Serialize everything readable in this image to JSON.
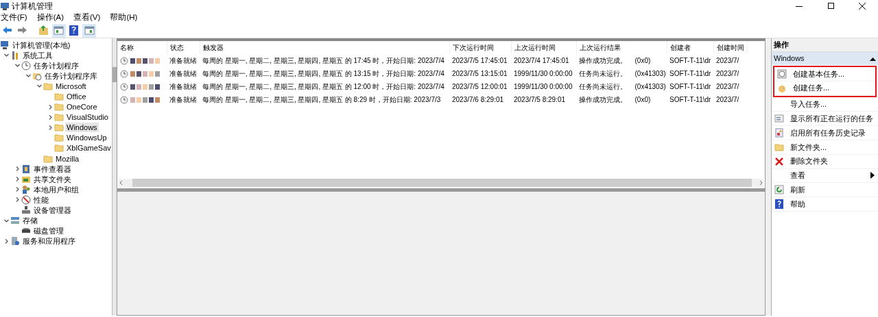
{
  "window": {
    "title": "计算机管理"
  },
  "menu": [
    "文件(F)",
    "操作(A)",
    "查看(V)",
    "帮助(H)"
  ],
  "toolbar": [
    {
      "kind": "back"
    },
    {
      "kind": "forward"
    },
    {
      "kind": "up-folder"
    },
    {
      "kind": "pane",
      "selected": true
    },
    {
      "kind": "help"
    },
    {
      "kind": "pane2",
      "selected": true
    }
  ],
  "tree": [
    {
      "label": "计算机管理(本地)",
      "kind": "computer",
      "selected": false,
      "children": [
        {
          "label": "系统工具",
          "kind": "tools",
          "expanded": true,
          "selected": false,
          "children": [
            {
              "label": "任务计划程序",
              "kind": "clock",
              "expanded": true,
              "selected": false,
              "children": [
                {
                  "label": "任务计划程序库",
                  "kind": "library",
                  "expanded": true,
                  "selected": false,
                  "children": [
                    {
                      "label": "Microsoft",
                      "kind": "folder",
                      "expanded": true,
                      "selected": false,
                      "children": [
                        {
                          "label": "Office",
                          "kind": "folder",
                          "selected": false
                        },
                        {
                          "label": "OneCore",
                          "kind": "folder",
                          "expanded": false,
                          "selected": false
                        },
                        {
                          "label": "VisualStudio",
                          "kind": "folder",
                          "expanded": false,
                          "selected": false
                        },
                        {
                          "label": "Windows",
                          "kind": "folder",
                          "expanded": false,
                          "selected": true
                        },
                        {
                          "label": "WindowsUp",
                          "kind": "folder",
                          "selected": false
                        },
                        {
                          "label": "XblGameSav",
                          "kind": "folder",
                          "selected": false
                        }
                      ]
                    },
                    {
                      "label": "Mozilla",
                      "kind": "folder",
                      "selected": false
                    }
                  ]
                }
              ]
            },
            {
              "label": "事件查看器",
              "kind": "events",
              "expanded": false,
              "selected": false
            },
            {
              "label": "共享文件夹",
              "kind": "share",
              "expanded": false,
              "selected": false
            },
            {
              "label": "本地用户和组",
              "kind": "users",
              "expanded": false,
              "selected": false
            },
            {
              "label": "性能",
              "kind": "perf",
              "expanded": false,
              "selected": false
            },
            {
              "label": "设备管理器",
              "kind": "device",
              "selected": false
            }
          ]
        },
        {
          "label": "存储",
          "kind": "storage",
          "expanded": true,
          "selected": false,
          "children": [
            {
              "label": "磁盘管理",
              "kind": "disk",
              "selected": false
            }
          ]
        },
        {
          "label": "服务和应用程序",
          "kind": "services",
          "expanded": false,
          "selected": false
        }
      ]
    }
  ],
  "table": {
    "columns": [
      "名称",
      "状态",
      "触发器",
      "下次运行时间",
      "上次运行时间",
      "上次运行结果",
      "创建者",
      "创建时间"
    ],
    "rows": [
      {
        "status": "准备就绪",
        "trigger": "每周的 星期一, 星期二, 星期三, 星期四, 星期五 的 17:45 时，开始日期: 2023/7/4",
        "next_run": "2023/7/5 17:45:01",
        "last_run": "2023/7/4 17:45:01",
        "result": "操作成功完成。",
        "result_code": "(0x0)",
        "author": "SOFT-T-11\\dr",
        "created": "2023/7/"
      },
      {
        "status": "准备就绪",
        "trigger": "每周的 星期一, 星期二, 星期三, 星期四, 星期五 的 13:15 时，开始日期: 2023/7/4",
        "next_run": "2023/7/5 13:15:01",
        "last_run": "1999/11/30 0:00:00",
        "result": "任务尚未运行。",
        "result_code": "(0x41303)",
        "author": "SOFT-T-11\\dr",
        "created": "2023/7/"
      },
      {
        "status": "准备就绪",
        "trigger": "每周的 星期一, 星期二, 星期三, 星期四, 星期五 的 12:00 时，开始日期: 2023/7/4",
        "next_run": "2023/7/5 12:00:01",
        "last_run": "1999/11/30 0:00:00",
        "result": "任务尚未运行。",
        "result_code": "(0x41303)",
        "author": "SOFT-T-11\\dr",
        "created": "2023/7/"
      },
      {
        "status": "准备就绪",
        "trigger": "每周的 星期一, 星期二, 星期三, 星期四, 星期五 的 8:29 时，开始日期: 2023/7/3",
        "next_run": "2023/7/6 8:29:01",
        "last_run": "2023/7/5 8:29:01",
        "result": "操作成功完成。",
        "result_code": "(0x0)",
        "author": "SOFT-T-11\\dr",
        "created": "2023/7/"
      }
    ]
  },
  "actions": {
    "title": "操作",
    "section": {
      "title": "Windows",
      "expanded": true
    },
    "items": [
      {
        "label": "创建基本任务...",
        "kind": "basic-task",
        "highlighted": true
      },
      {
        "label": "创建任务...",
        "kind": "task",
        "highlighted": true
      },
      {
        "label": "导入任务...",
        "kind": "none",
        "highlighted": false
      },
      {
        "label": "显示所有正在运行的任务",
        "kind": "running",
        "highlighted": false
      },
      {
        "label": "启用所有任务历史记录",
        "kind": "history",
        "highlighted": false
      },
      {
        "label": "新文件夹...",
        "kind": "folder",
        "highlighted": false
      },
      {
        "label": "删除文件夹",
        "kind": "delete",
        "highlighted": false
      },
      {
        "label": "查看",
        "kind": "submenu",
        "highlighted": false
      },
      {
        "label": "刷新",
        "kind": "refresh",
        "highlighted": false
      },
      {
        "label": "帮助",
        "kind": "help",
        "highlighted": false
      }
    ]
  }
}
